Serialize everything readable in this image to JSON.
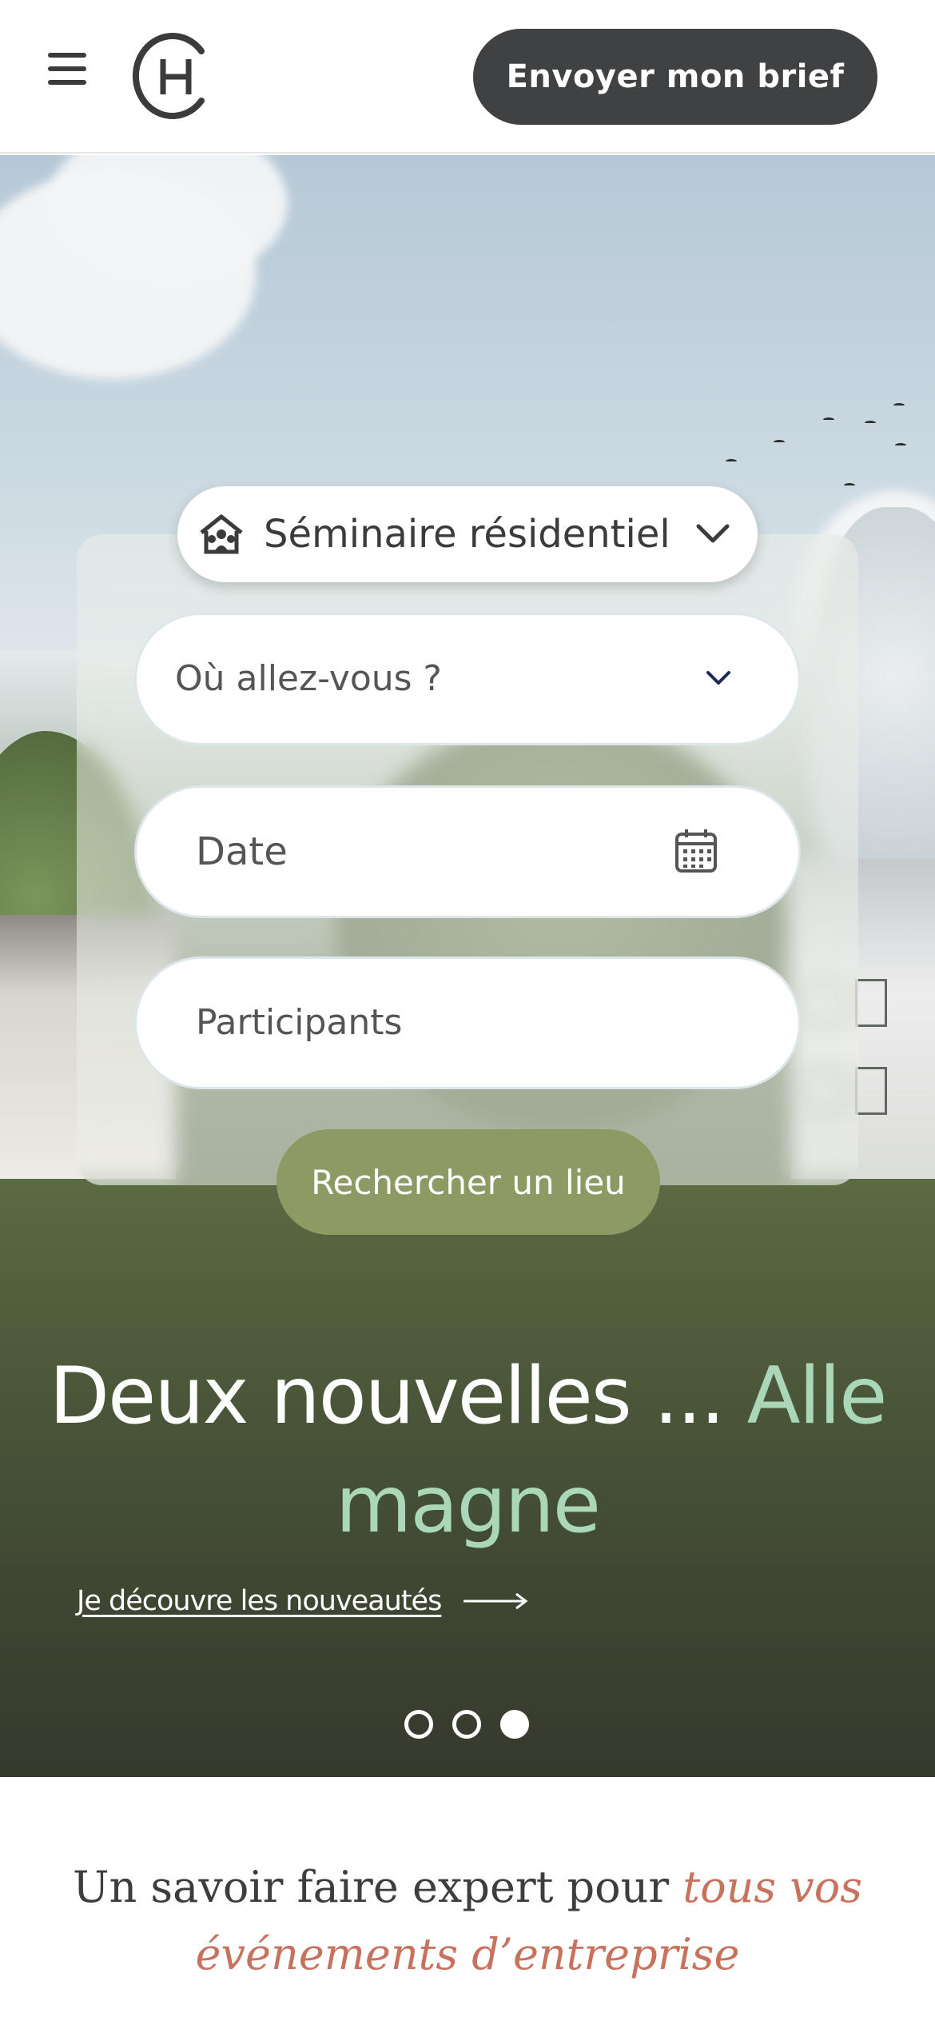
{
  "header": {
    "menu_icon": "hamburger-menu-icon",
    "logo_icon": "ch-logo-icon",
    "cta_label": "Envoyer mon brief"
  },
  "search": {
    "event_type": "Séminaire résidentiel",
    "event_type_icon": "house-people-icon",
    "where_placeholder": "Où allez-vous ?",
    "date_placeholder": "Date",
    "date_icon": "calendar-icon",
    "participants_placeholder": "Participants",
    "submit_label": "Rechercher un lieu"
  },
  "hero": {
    "headline_main": "Deux nouvelles ... ",
    "headline_accent": "Alle magne",
    "discover_link": "Je découvre les nouveautés",
    "slides_total": 3,
    "active_slide": 3
  },
  "section": {
    "tagline_main": "Un savoir faire expert pour ",
    "tagline_accent": "tous vos événements d’entreprise"
  },
  "colors": {
    "primary_dark": "#3f4143",
    "search_button": "#8d9a63",
    "headline_accent": "#a9d7b8",
    "tagline_accent": "#c8725d"
  }
}
